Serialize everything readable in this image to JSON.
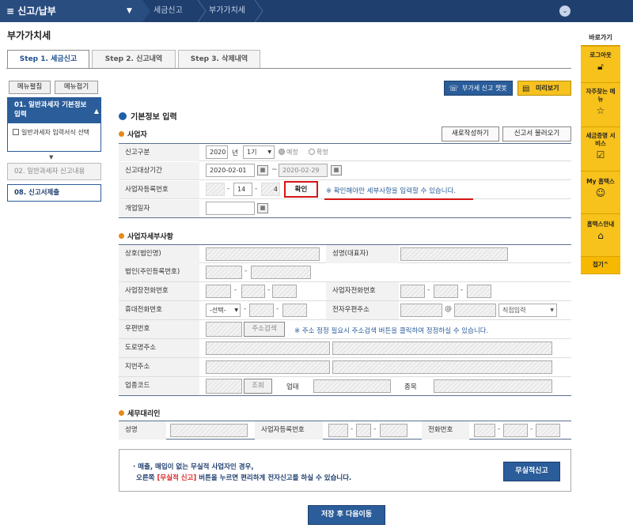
{
  "topbar": {
    "menu": "≡ 신고/납부",
    "crumb1": "세금신고",
    "crumb2": "부가가치세"
  },
  "page_title": "부가가치세",
  "tabs": [
    {
      "label": "Step 1. 세금신고"
    },
    {
      "label": "Step 2. 신고내역"
    },
    {
      "label": "Step 3. 삭제내역"
    }
  ],
  "side": {
    "open_all": "메뉴펼침",
    "close_all": "메뉴접기",
    "step1": "01. 일반과세자 기본정보 입력",
    "step1_sub": "일반과세자 입력서식 선택",
    "step2": "02. 일반과세자 신고내용",
    "step3": "08. 신고서제출"
  },
  "top_buttons": {
    "chatbot": "부가세 신고 챗봇",
    "preview": "미리보기"
  },
  "basic": {
    "title": "기본정보 입력",
    "business_title": "사업자",
    "new_btn": "새로작성하기",
    "load_btn": "신고서 불러오기",
    "report_type_label": "신고구분",
    "year": "2020",
    "year_unit": "년",
    "period": "1기",
    "opt_scheduled": "예정",
    "opt_final": "확정",
    "period_label": "신고대상기간",
    "date_from": "2020-02-01",
    "tilde": "~",
    "date_to": "2020-02-29",
    "bizno_label": "사업자등록번호",
    "bizno_mid": "14",
    "bizno_end": "4",
    "confirm_btn": "확인",
    "confirm_note": "※ 확인해야만 세부사항을 입력할 수 있습니다.",
    "opening_label": "개업일자"
  },
  "details": {
    "title": "사업자세부사항",
    "company_label": "상호(법인명)",
    "ceo_label": "성명(대표자)",
    "corpno_label": "법인(주민등록번호)",
    "phone_label": "사업장전화번호",
    "phone2_label": "사업자전화번호",
    "mobile_label": "휴대전화번호",
    "mobile_select": "-선택-",
    "email_label": "전자우편주소",
    "at": "@",
    "email_domain": "직접입력",
    "zip_label": "우편번호",
    "zip_btn": "주소검색",
    "zip_note": "※ 주소 정정 필요시 주소검색 버튼을 클릭하여 정정하실 수 있습니다.",
    "road_label": "도로명주소",
    "jibun_label": "지번주소",
    "industry_label": "업종코드",
    "lookup_btn": "조회",
    "biz_type_label": "업태",
    "item_label": "종목"
  },
  "agent": {
    "title": "세무대리인",
    "name_label": "성명",
    "bizno_label": "사업자등록번호",
    "phone_label": "전화번호"
  },
  "notice": {
    "line1": "· 매출, 매입이 없는 무실적 사업자인 경우,",
    "line2_a": "오른쪽",
    "line2_red": "[무실적 신고]",
    "line2_b": "버튼을 누르면 편리하게 전자신고를 하실 수 있습니다.",
    "btn": "무실적신고"
  },
  "save_btn": "저장 후 다음이동",
  "quick": {
    "title": "바로가기",
    "logout": "로그아웃",
    "faq": "자주찾는 메뉴",
    "docs": "세금증명 서비스",
    "my": "My 홈택스",
    "guide": "홈택스안내",
    "collapse": "접기^"
  }
}
